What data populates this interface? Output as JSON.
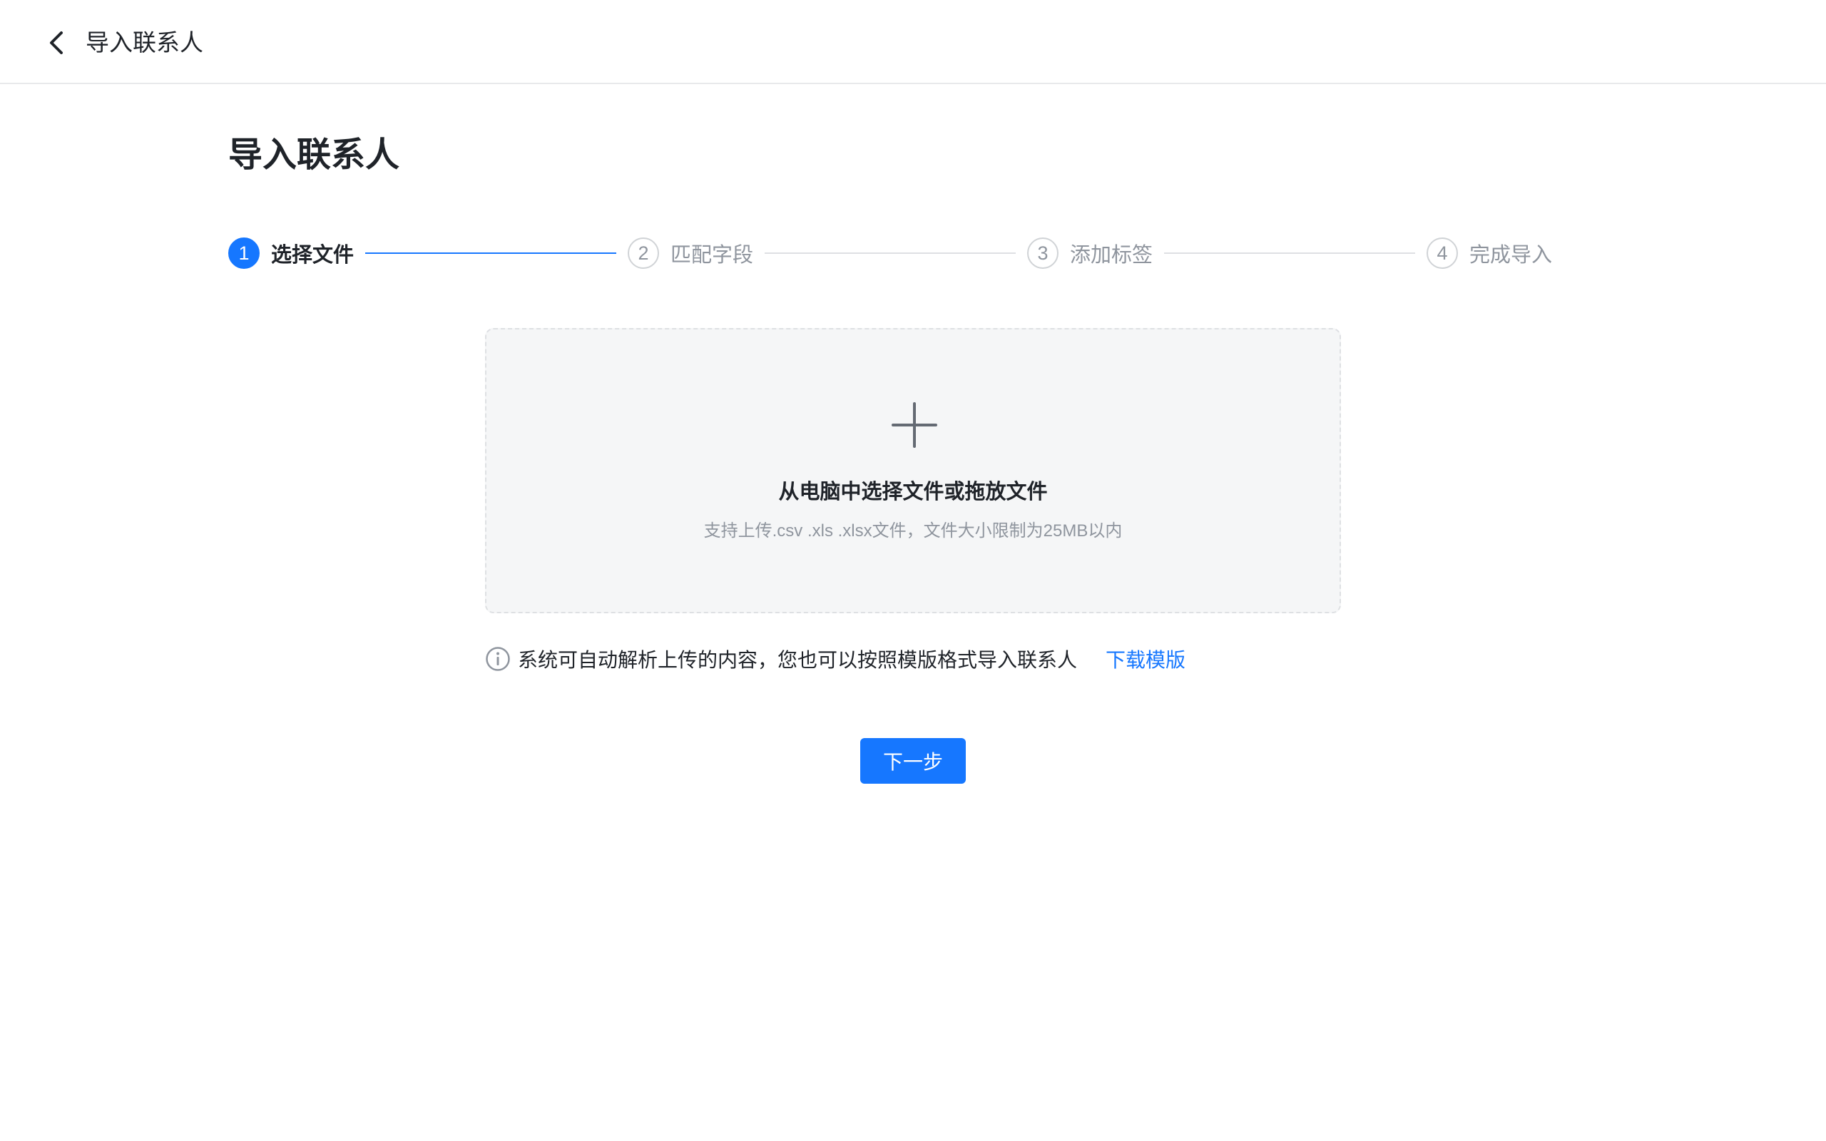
{
  "header": {
    "back_icon": "chevron-left-icon",
    "title": "导入联系人"
  },
  "page": {
    "title": "导入联系人"
  },
  "steps": [
    {
      "number": "1",
      "label": "选择文件",
      "state": "active"
    },
    {
      "number": "2",
      "label": "匹配字段",
      "state": "pending"
    },
    {
      "number": "3",
      "label": "添加标签",
      "state": "pending"
    },
    {
      "number": "4",
      "label": "完成导入",
      "state": "pending"
    }
  ],
  "upload": {
    "icon": "plus-icon",
    "title": "从电脑中选择文件或拖放文件",
    "hint": "支持上传.csv .xls .xlsx文件，文件大小限制为25MB以内"
  },
  "info": {
    "icon": "info-circle-icon",
    "text": "系统可自动解析上传的内容，您也可以按照模版格式导入联系人",
    "link": "下载模版"
  },
  "actions": {
    "next_label": "下一步"
  },
  "colors": {
    "accent": "#1677ff",
    "text": "#1f2329",
    "muted": "#8f959e",
    "upload_bg": "#f5f6f7"
  }
}
